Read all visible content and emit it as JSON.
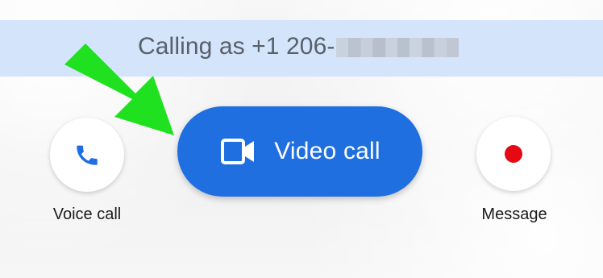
{
  "banner": {
    "text": "Calling as +1 206-"
  },
  "actions": {
    "voice_call_label": "Voice call",
    "video_call_label": "Video call",
    "message_label": "Message"
  },
  "icons": {
    "voice": "phone-icon",
    "video": "video-camera-icon",
    "message": "record-dot-icon",
    "annotation": "green-arrow-icon"
  },
  "colors": {
    "accent_blue": "#1f6fe0",
    "record_red": "#e50914",
    "arrow_green": "#1fe11f",
    "banner_bg": "#d4e4fb"
  }
}
